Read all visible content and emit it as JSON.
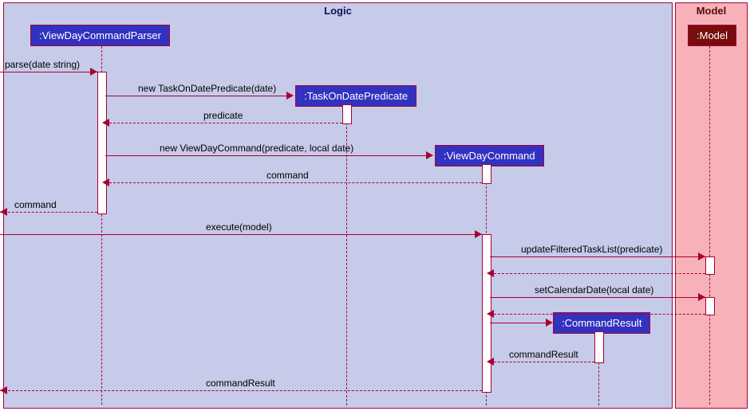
{
  "frames": {
    "logic": "Logic",
    "model": "Model"
  },
  "participants": {
    "parser": ":ViewDayCommandParser",
    "predicate": ":TaskOnDatePredicate",
    "command": ":ViewDayCommand",
    "result": ":CommandResult",
    "model": ":Model"
  },
  "messages": {
    "m1": "parse(date string)",
    "m2": "new TaskOnDatePredicate(date)",
    "r2": "predicate",
    "m3": "new ViewDayCommand(predicate, local date)",
    "r3": "command",
    "r_parse": "command",
    "m4": "execute(model)",
    "m5": "updateFilteredTaskList(predicate)",
    "m6": "setCalendarDate(local date)",
    "m7": ":CommandResult",
    "r7": "commandResult",
    "r_exec": "commandResult"
  }
}
